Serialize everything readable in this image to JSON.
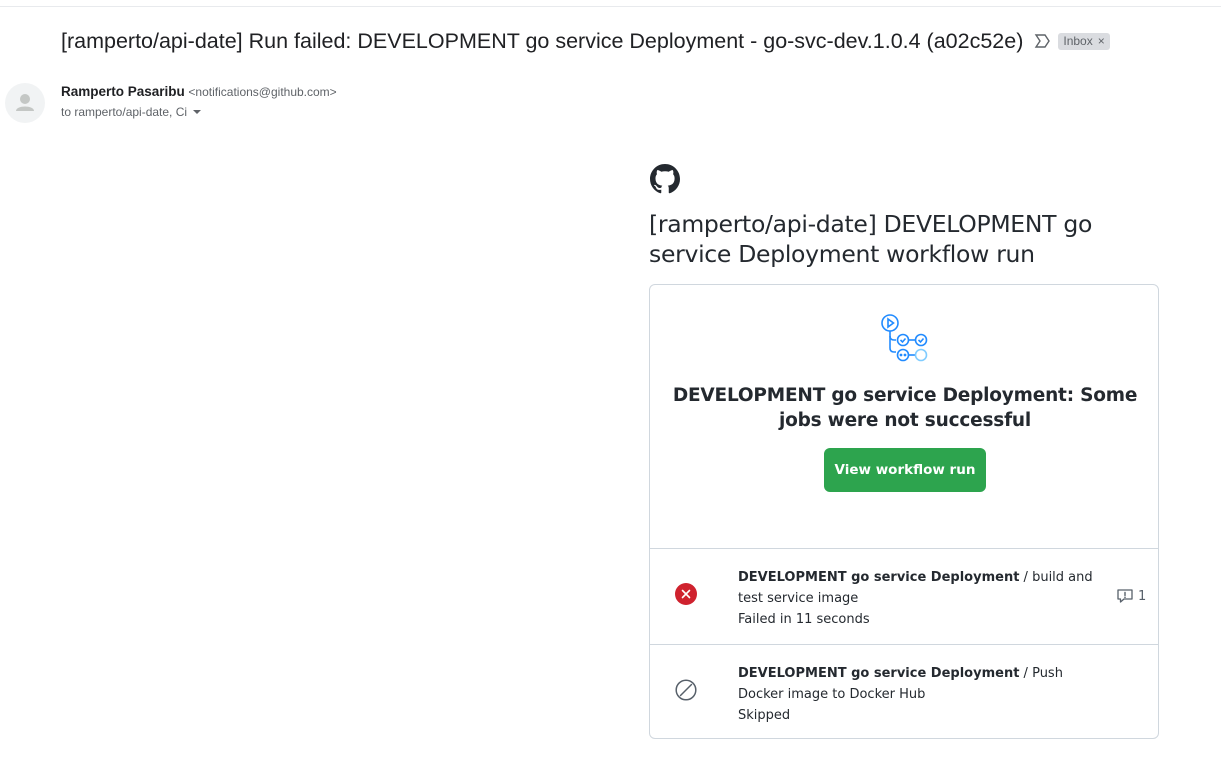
{
  "email": {
    "subject": "[ramperto/api-date] Run failed: DEVELOPMENT go service Deployment - go-svc-dev.1.0.4 (a02c52e)",
    "label": "Inbox",
    "label_close": "×",
    "sender_name": "Ramperto Pasaribu",
    "sender_email": "<notifications@github.com>",
    "recipients": "to ramperto/api-date, Ci"
  },
  "body": {
    "heading": "[ramperto/api-date] DEVELOPMENT go service Deployment workflow run",
    "card_title": "DEVELOPMENT go service Deployment: Some jobs were not successful",
    "button_label": "View workflow run",
    "jobs": [
      {
        "workflow": "DEVELOPMENT go service Deployment",
        "separator": " / ",
        "job": "build and test service image",
        "status": "Failed in 11 seconds",
        "annotations": "1",
        "status_icon": "x-circle-icon"
      },
      {
        "workflow": "DEVELOPMENT go service Deployment",
        "separator": " / ",
        "job": "Push Docker image to Docker Hub",
        "status": "Skipped",
        "status_icon": "skipped-icon"
      }
    ]
  },
  "colors": {
    "success_button": "#2da44e",
    "failure": "#cf222e",
    "workflow_icon": "#218bff"
  }
}
